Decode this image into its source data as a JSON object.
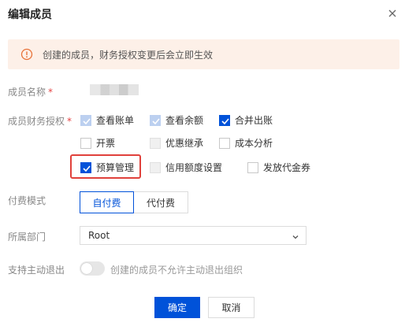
{
  "dialog": {
    "title": "编辑成员",
    "alert_text": "创建的成员，财务授权变更后会立即生效",
    "name_label": "成员名称",
    "required_mark": "*",
    "permissions_label": "成员财务授权",
    "permissions": [
      {
        "label": "查看账单",
        "state": "checked-disabled"
      },
      {
        "label": "查看余额",
        "state": "checked-disabled"
      },
      {
        "label": "合并出账",
        "state": "checked"
      },
      {
        "label": "开票",
        "state": "unchecked"
      },
      {
        "label": "优惠继承",
        "state": "disabled"
      },
      {
        "label": "成本分析",
        "state": "unchecked"
      },
      {
        "label": "预算管理",
        "state": "checked"
      },
      {
        "label": "信用额度设置",
        "state": "disabled"
      },
      {
        "label": "发放代金券",
        "state": "unchecked"
      }
    ],
    "payment_label": "付费模式",
    "payment_options": [
      "自付费",
      "代付费"
    ],
    "payment_selected": "自付费",
    "department_label": "所属部门",
    "department_value": "Root",
    "exit_label": "支持主动退出",
    "exit_toggle_on": false,
    "exit_text": "创建的成员不允许主动退出组织",
    "confirm_label": "确定",
    "cancel_label": "取消"
  },
  "colors": {
    "primary": "#0052d9",
    "alert_bg": "#fdf0e8",
    "alert_icon": "#e8733a",
    "highlight": "#e0413b"
  }
}
